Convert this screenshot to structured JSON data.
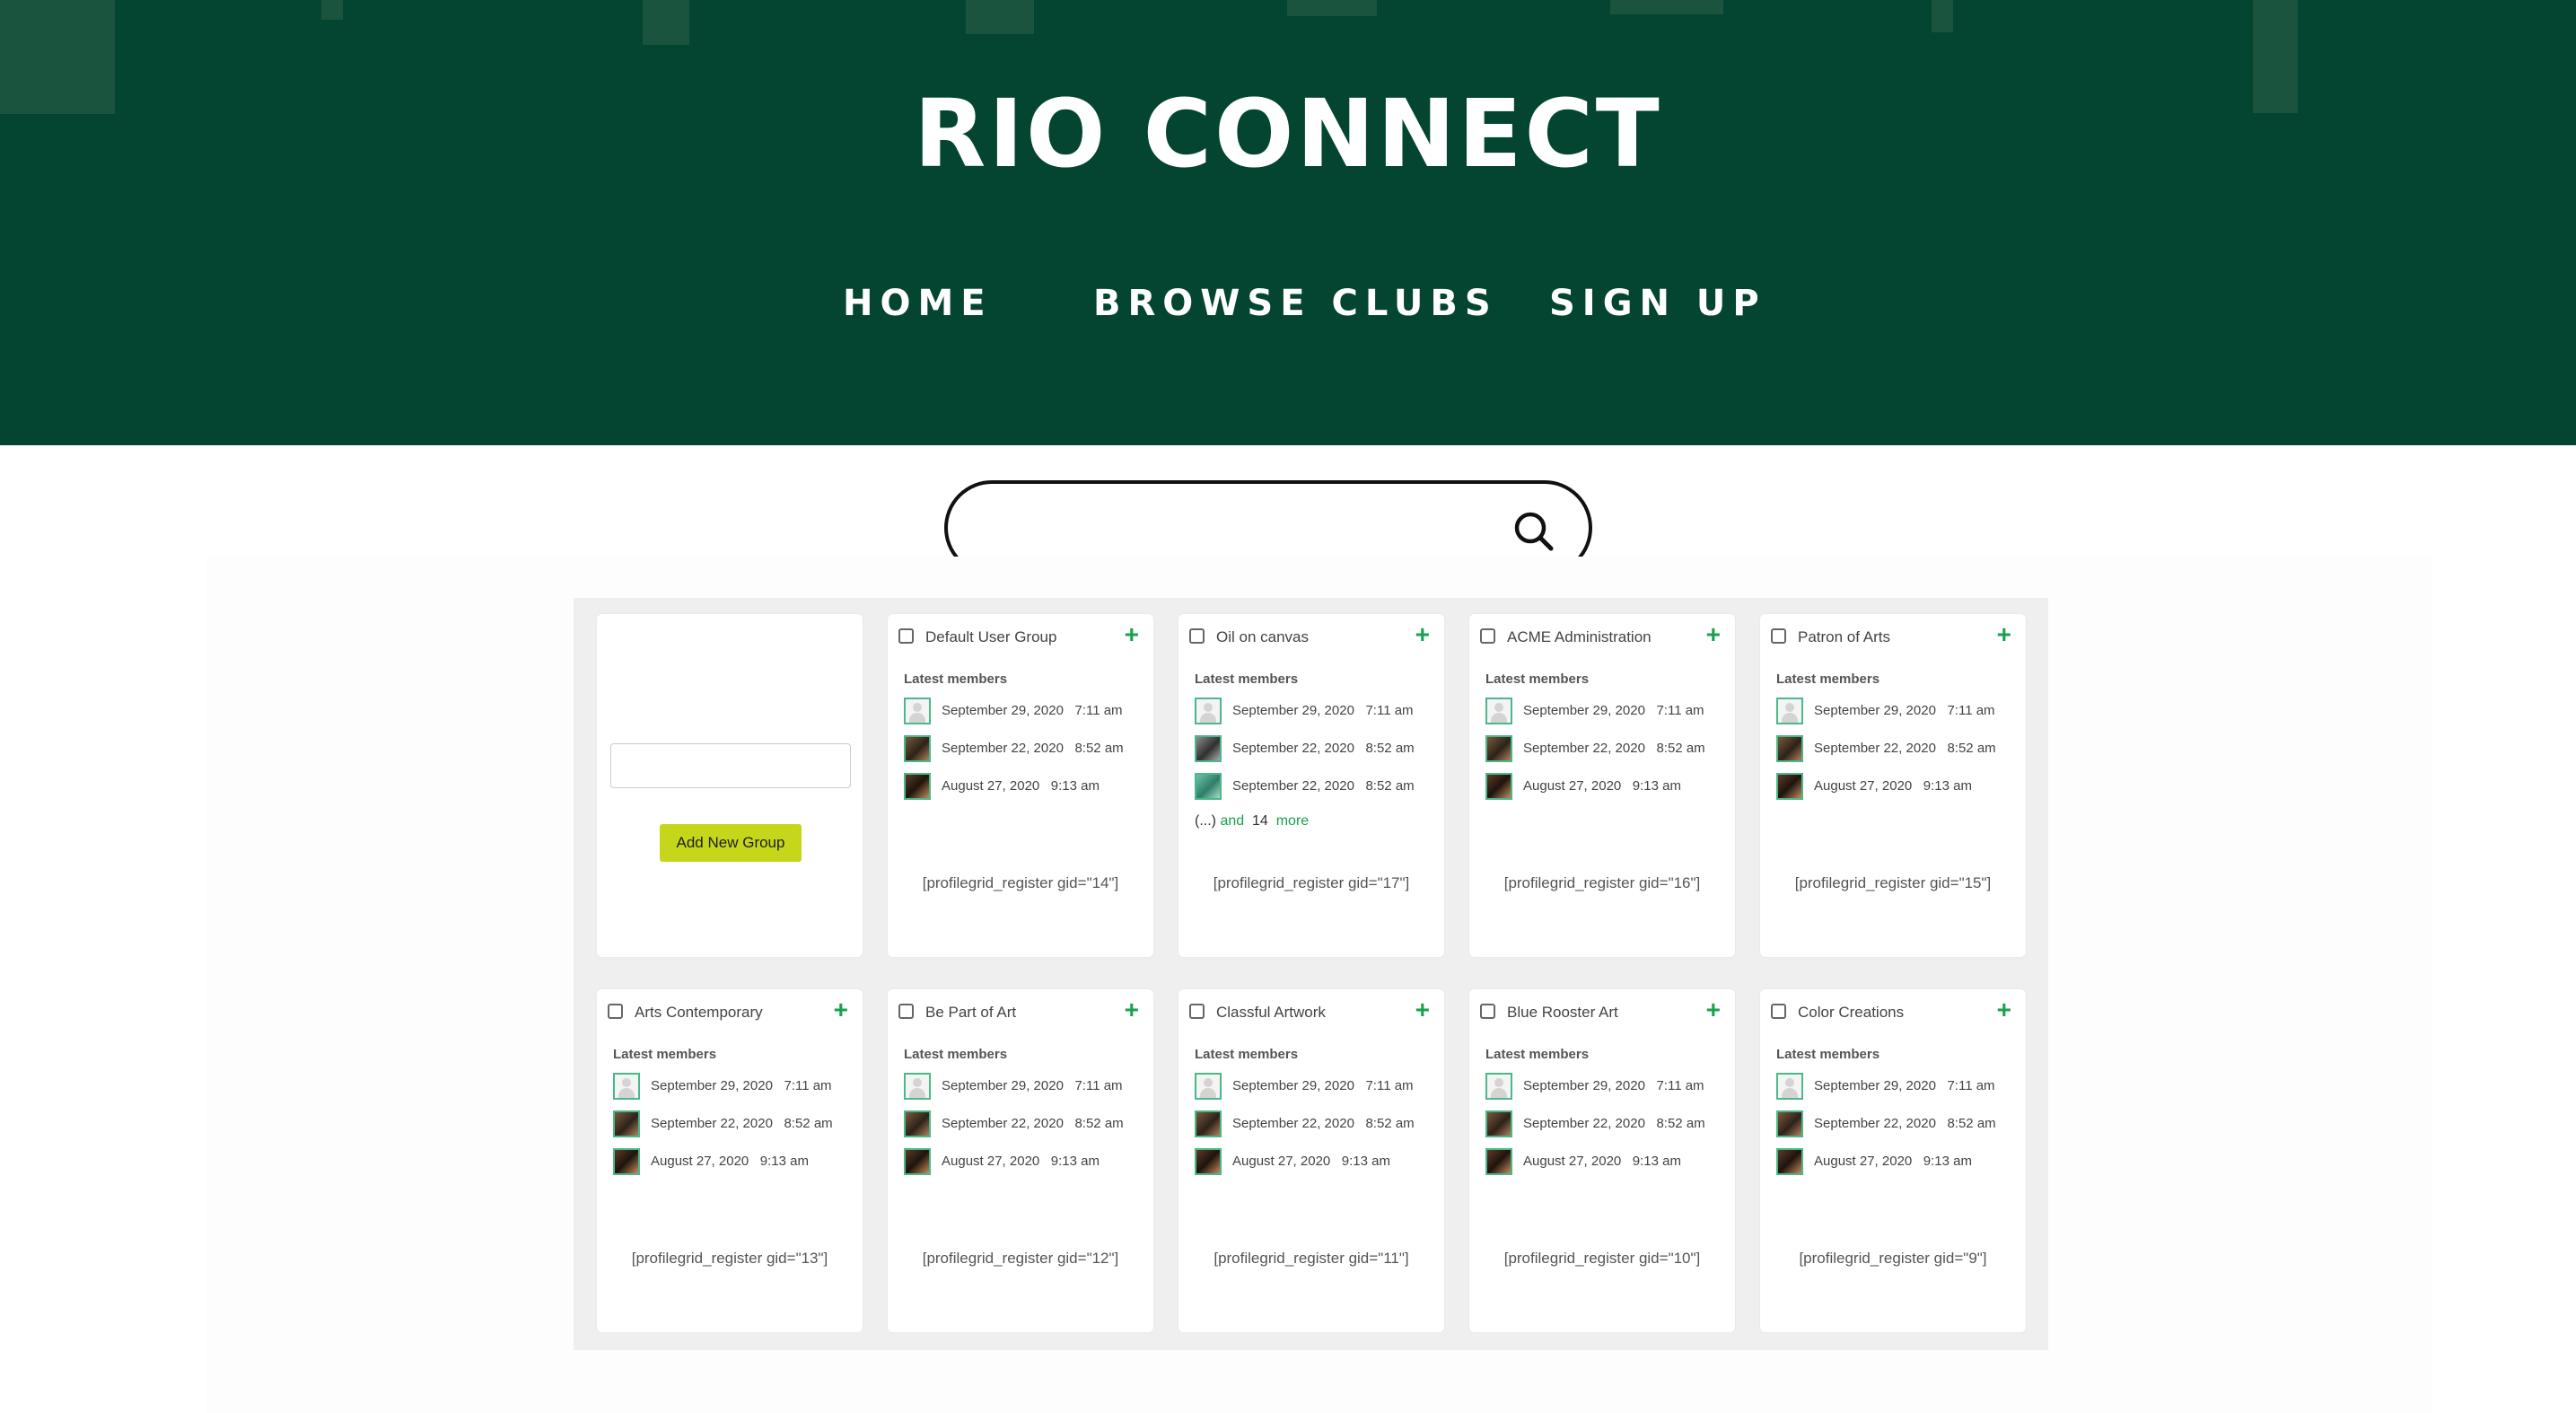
{
  "site": {
    "title": "RIO CONNECT",
    "nav": [
      "HOME",
      "BROWSE CLUBS",
      "SIGN UP"
    ],
    "colors": {
      "header_bg": "#034530",
      "accent_green": "#1aa150",
      "add_button": "#c6d61b"
    }
  },
  "search": {
    "placeholder": "",
    "icon": "search-icon"
  },
  "new_group": {
    "input_value": "",
    "button_label": "Add New Group"
  },
  "latest_members_label": "Latest members",
  "groups": [
    {
      "name": "Default User Group",
      "members": [
        [
          "September 29, 2020",
          "7:11 am"
        ],
        [
          "September 22, 2020",
          "8:52 am"
        ],
        [
          "August 27, 2020",
          "9:13 am"
        ]
      ],
      "shortcode": "[profilegrid_register gid=\"14\"]"
    },
    {
      "name": "Oil on canvas",
      "members": [
        [
          "September 29, 2020",
          "7:11 am"
        ],
        [
          "September 22, 2020",
          "8:52 am"
        ],
        [
          "September 22, 2020",
          "8:52 am"
        ]
      ],
      "more": {
        "prefix": "(...) ",
        "and": "and",
        "count": "14",
        "more": "more"
      },
      "shortcode": "[profilegrid_register gid=\"17\"]"
    },
    {
      "name": "ACME Administration",
      "members": [
        [
          "September 29, 2020",
          "7:11 am"
        ],
        [
          "September 22, 2020",
          "8:52 am"
        ],
        [
          "August 27, 2020",
          "9:13 am"
        ]
      ],
      "shortcode": "[profilegrid_register gid=\"16\"]"
    },
    {
      "name": "Patron of Arts",
      "members": [
        [
          "September 29, 2020",
          "7:11 am"
        ],
        [
          "September 22, 2020",
          "8:52 am"
        ],
        [
          "August 27, 2020",
          "9:13 am"
        ]
      ],
      "shortcode": "[profilegrid_register gid=\"15\"]"
    },
    {
      "name": "Arts Contemporary",
      "members": [
        [
          "September 29, 2020",
          "7:11 am"
        ],
        [
          "September 22, 2020",
          "8:52 am"
        ],
        [
          "August 27, 2020",
          "9:13 am"
        ]
      ],
      "shortcode": "[profilegrid_register gid=\"13\"]"
    },
    {
      "name": "Be Part of Art",
      "members": [
        [
          "September 29, 2020",
          "7:11 am"
        ],
        [
          "September 22, 2020",
          "8:52 am"
        ],
        [
          "August 27, 2020",
          "9:13 am"
        ]
      ],
      "shortcode": "[profilegrid_register gid=\"12\"]"
    },
    {
      "name": "Classful Artwork",
      "members": [
        [
          "September 29, 2020",
          "7:11 am"
        ],
        [
          "September 22, 2020",
          "8:52 am"
        ],
        [
          "August 27, 2020",
          "9:13 am"
        ]
      ],
      "shortcode": "[profilegrid_register gid=\"11\"]"
    },
    {
      "name": "Blue Rooster Art",
      "members": [
        [
          "September 29, 2020",
          "7:11 am"
        ],
        [
          "September 22, 2020",
          "8:52 am"
        ],
        [
          "August 27, 2020",
          "9:13 am"
        ]
      ],
      "shortcode": "[profilegrid_register gid=\"10\"]"
    },
    {
      "name": "Color Creations",
      "members": [
        [
          "September 29, 2020",
          "7:11 am"
        ],
        [
          "September 22, 2020",
          "8:52 am"
        ],
        [
          "August 27, 2020",
          "9:13 am"
        ]
      ],
      "shortcode": "[profilegrid_register gid=\"9\"]"
    }
  ]
}
